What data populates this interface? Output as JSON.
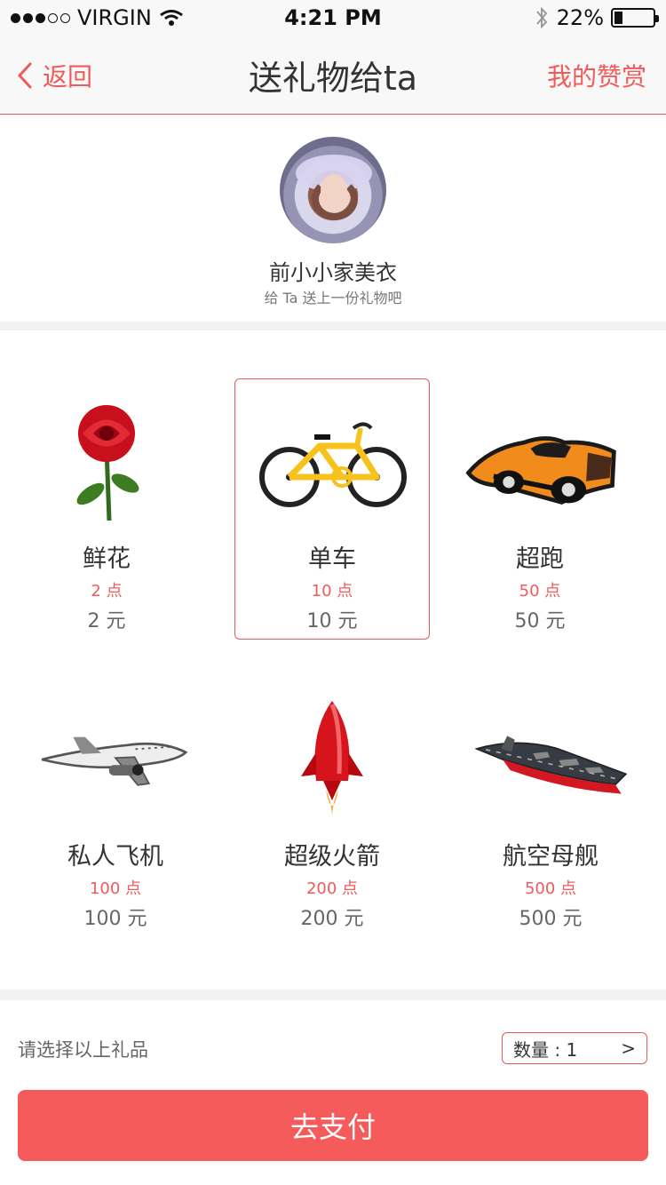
{
  "status_bar": {
    "carrier": "VIRGIN",
    "time": "4:21 PM",
    "battery": "22%",
    "battery_level": 0.22
  },
  "nav": {
    "back_label": "返回",
    "title": "送礼物给ta",
    "right_label": "我的赞赏"
  },
  "profile": {
    "name": "前小小家美衣",
    "subtitle": "给 Ta 送上一份礼物吧"
  },
  "gifts": [
    {
      "name": "鲜花",
      "points": "2 点",
      "price": "2 元",
      "icon": "rose-icon",
      "selected": false
    },
    {
      "name": "单车",
      "points": "10 点",
      "price": "10 元",
      "icon": "bicycle-icon",
      "selected": true
    },
    {
      "name": "超跑",
      "points": "50 点",
      "price": "50 元",
      "icon": "sports-car-icon",
      "selected": false
    },
    {
      "name": "私人飞机",
      "points": "100 点",
      "price": "100 元",
      "icon": "airplane-icon",
      "selected": false
    },
    {
      "name": "超级火箭",
      "points": "200 点",
      "price": "200 元",
      "icon": "rocket-icon",
      "selected": false
    },
    {
      "name": "航空母舰",
      "points": "500 点",
      "price": "500 元",
      "icon": "aircraft-carrier-icon",
      "selected": false
    }
  ],
  "footer": {
    "hint": "请选择以上礼品",
    "quantity_label": "数量 : 1",
    "quantity_arrow": ">",
    "pay_label": "去支付"
  },
  "colors": {
    "accent": "#f15a5a",
    "button": "#f55b5b",
    "background": "#f2f2f2"
  }
}
